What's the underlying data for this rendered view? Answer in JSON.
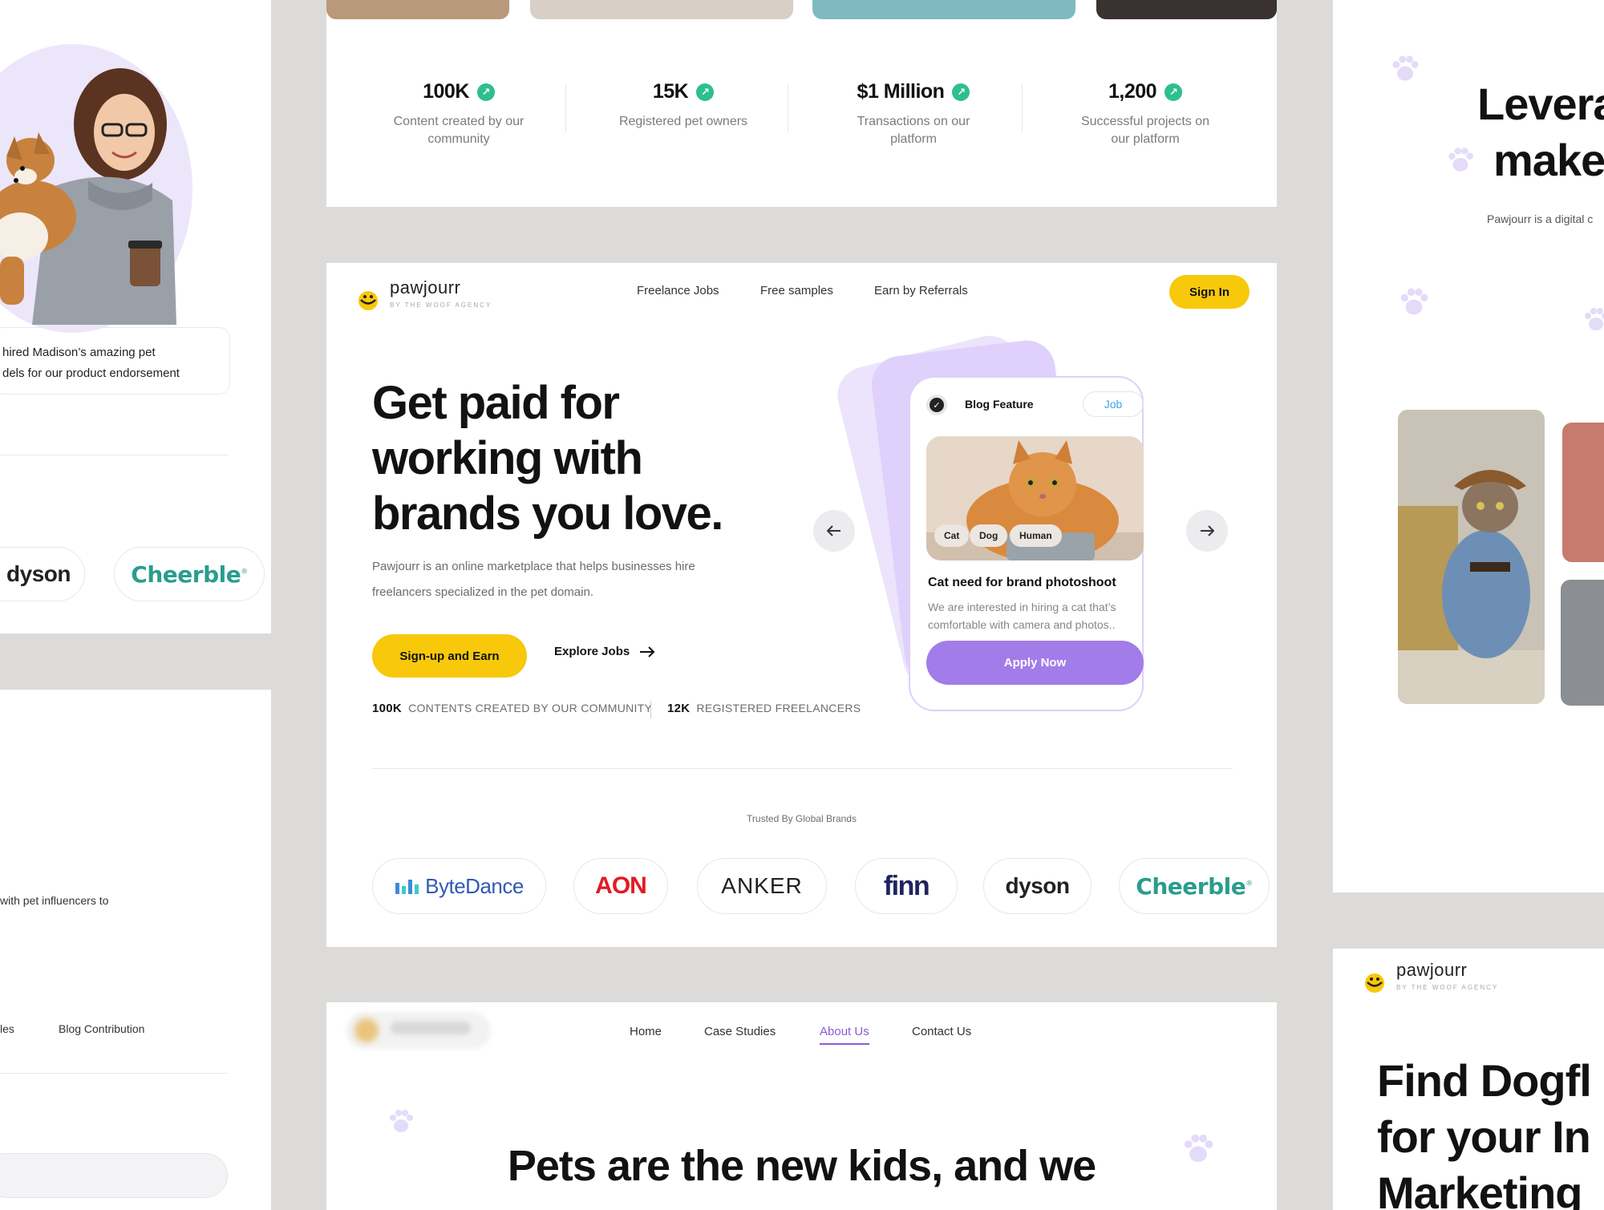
{
  "colors": {
    "accent_yellow": "#f8c80a",
    "accent_purple": "#a27ce8",
    "badge_green": "#2ebf8e",
    "background": "#dcdbd9"
  },
  "left_panel": {
    "testimonial_line1": "hired Madison’s amazing pet",
    "testimonial_line2": "dels for our product endorsement",
    "logos": [
      "dyson",
      "Cheerble"
    ],
    "fragment_text": "with pet influencers to",
    "nav_fragment": "les",
    "nav_blog": "Blog Contribution"
  },
  "stats": [
    {
      "value": "100K",
      "label": "Content created by our community"
    },
    {
      "value": "15K",
      "label": "Registered pet owners"
    },
    {
      "value": "$1 Million",
      "label": "Transactions on our platform"
    },
    {
      "value": "1,200",
      "label": "Successful projects on our platform"
    }
  ],
  "header": {
    "brand_name": "pawjourr",
    "brand_sub": "BY THE WOOF AGENCY",
    "nav": [
      "Freelance Jobs",
      "Free samples",
      "Earn by Referrals"
    ],
    "sign_in": "Sign In"
  },
  "hero": {
    "title_lines": [
      "Get paid for",
      "working with",
      "brands you love."
    ],
    "description_lines": [
      "Pawjourr is an online marketplace that helps businesses hire",
      "freelancers specialized in the pet domain."
    ],
    "cta_primary": "Sign-up and Earn",
    "cta_secondary": "Explore Jobs",
    "mini_stats": [
      {
        "value": "100K",
        "label": "CONTENTS CREATED BY OUR COMMUNITY"
      },
      {
        "value": "12K",
        "label": "REGISTERED FREELANCERS"
      }
    ]
  },
  "job_card": {
    "type": "Blog Feature",
    "tag": "Job",
    "chips": [
      "Cat",
      "Dog",
      "Human"
    ],
    "title": "Cat need for brand photoshoot",
    "description_lines": [
      "We are interested in hiring a cat that’s",
      "comfortable with camera and photos.."
    ],
    "apply": "Apply Now"
  },
  "trusted": {
    "label": "Trusted By Global Brands",
    "brands": [
      "ByteDance",
      "AON",
      "ANKER",
      "finn",
      "dyson",
      "Cheerble"
    ]
  },
  "about_page": {
    "nav": [
      "Home",
      "Case Studies",
      "About Us",
      "Contact Us"
    ],
    "active_nav": "About Us",
    "title": "Pets are the new kids, and we"
  },
  "right_panel": {
    "title_lines": [
      "Levera",
      "make"
    ],
    "description": "Pawjourr is a digital c",
    "brand_name": "pawjourr",
    "brand_sub": "BY THE WOOF AGENCY",
    "bottom_title_lines": [
      "Find Dogfl",
      "for your In",
      "Marketing"
    ]
  }
}
